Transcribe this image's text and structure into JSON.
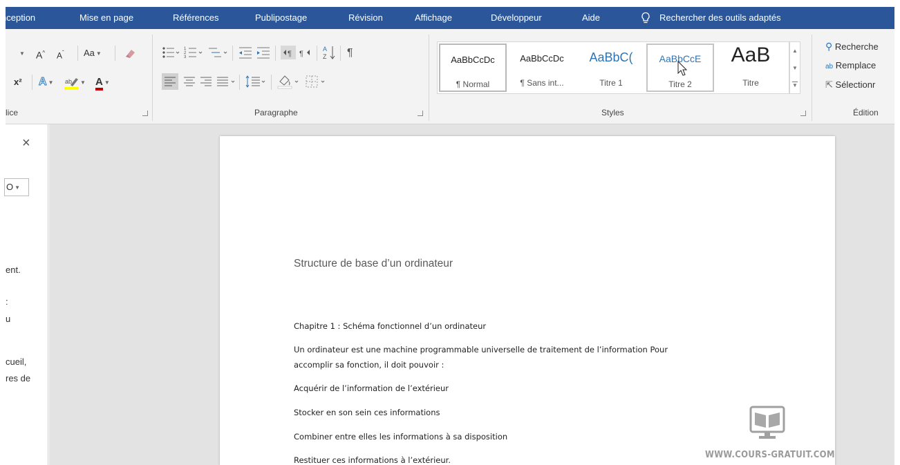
{
  "tabs": [
    {
      "label": "nception"
    },
    {
      "label": "Mise en page"
    },
    {
      "label": "Références"
    },
    {
      "label": "Publipostage"
    },
    {
      "label": "Révision"
    },
    {
      "label": "Affichage"
    },
    {
      "label": "Développeur"
    },
    {
      "label": "Aide"
    }
  ],
  "tell_me": {
    "icon": "lightbulb-icon",
    "label": "Rechercher des outils adaptés"
  },
  "font_group": {
    "grow_font": "A",
    "shrink_font": "A",
    "change_case": "Aa",
    "superscript": "x²",
    "text_effects": "A",
    "font_color": "A",
    "label": "lice"
  },
  "paragraph_group": {
    "label": "Paragraphe",
    "show_marks": "¶"
  },
  "styles_group": {
    "label": "Styles",
    "items": [
      {
        "preview": "AaBbCcDc",
        "name": "¶ Normal"
      },
      {
        "preview": "AaBbCcDc",
        "name": "¶ Sans int..."
      },
      {
        "preview": "AaBbC(",
        "name": "Titre 1"
      },
      {
        "preview": "AaBbCcE",
        "name": "Titre 2"
      },
      {
        "preview": "AaB",
        "name": "Titre"
      }
    ]
  },
  "editing_group": {
    "label": "Édition",
    "find": "Recherche",
    "replace": "Remplace",
    "select": "Sélectionr"
  },
  "nav_pane": {
    "close": "×",
    "search_value": "O",
    "text_lines": [
      "ent.",
      ":",
      "u",
      "cueil,",
      "res de"
    ]
  },
  "document": {
    "title": "Structure de base d’un ordinateur",
    "lines": [
      "Chapitre 1 : Schéma fonctionnel  d’un ordinateur",
      "Un ordinateur est une machine programmable universelle de traitement de l’information Pour",
      "accomplir sa fonction, il doit pouvoir :",
      "Acquérir de l’information de l’extérieur",
      "Stocker en son sein ces informations",
      "Combiner entre elles les informations à sa disposition",
      "Restituer ces informations à l’extérieur."
    ]
  },
  "watermark": {
    "text": "WWW.COURS-GRATUIT.COM",
    "icon": "book-monitor-logo"
  },
  "colors": {
    "ribbon_blue": "#2b579a",
    "ribbon_bg": "#f3f3f3",
    "workspace": "#e3e3e3",
    "font_color_red": "#c00000",
    "highlight_yellow": "#ffff00"
  }
}
